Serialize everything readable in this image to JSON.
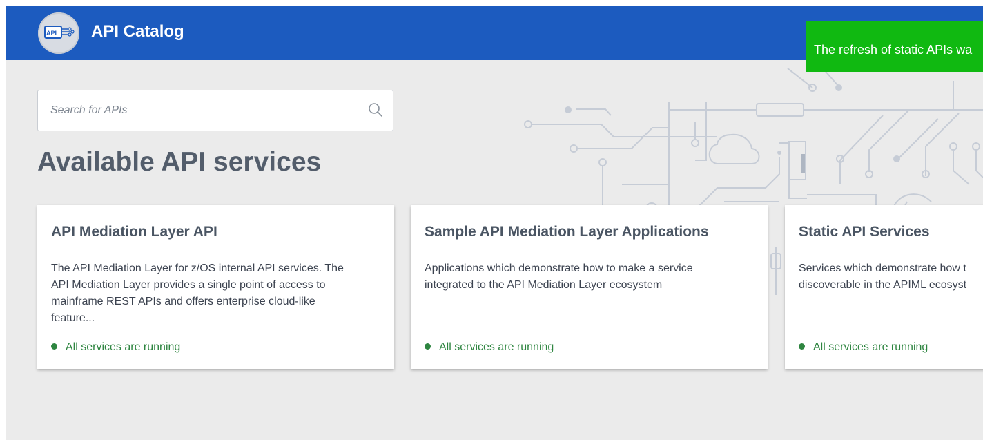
{
  "header": {
    "title": "API Catalog",
    "logo_icon": "api-catalog-logo",
    "background_color": "#1c5bbf"
  },
  "toast": {
    "message": "The refresh of static APIs wa",
    "background_color": "#10b911"
  },
  "search": {
    "placeholder": "Search for APIs",
    "value": "",
    "icon": "search-icon"
  },
  "page": {
    "title": "Available API services"
  },
  "cards": [
    {
      "title": "API Mediation Layer API",
      "description_lines": [
        "The API Mediation Layer for z/OS internal API services. The",
        "API Mediation Layer provides a single point of access to",
        "mainframe REST APIs and offers enterprise cloud-like",
        "feature..."
      ],
      "status": "All services are running"
    },
    {
      "title": "Sample API Mediation Layer Applications",
      "description_lines": [
        "Applications which demonstrate how to make a service",
        "integrated to the API Mediation Layer ecosystem"
      ],
      "status": "All services are running"
    },
    {
      "title": "Static API Services",
      "description_lines": [
        "Services which demonstrate how t",
        "discoverable in the APIML ecosyst"
      ],
      "status": "All services are running"
    }
  ],
  "colors": {
    "status_ok": "#2e8540",
    "page_background": "#ebebeb"
  }
}
